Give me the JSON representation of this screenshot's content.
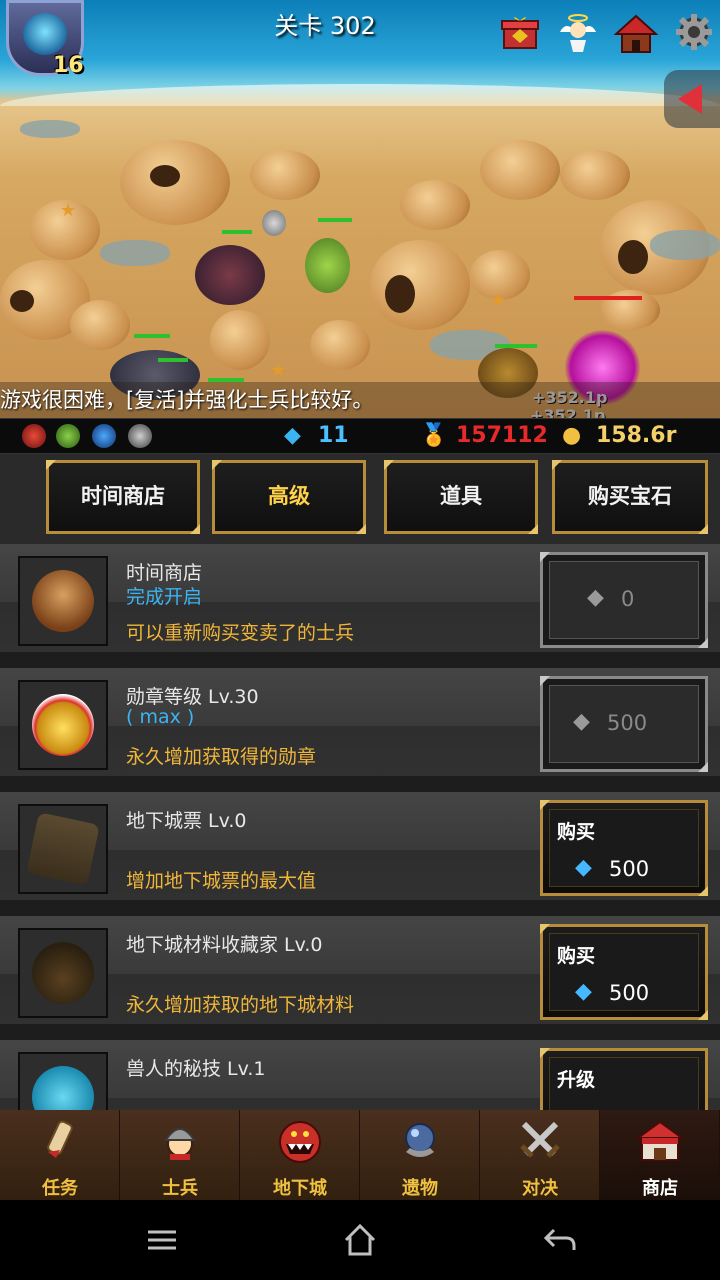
{
  "header": {
    "player_level": "16",
    "stage_title": "关卡 302",
    "icons": [
      "gift-box-icon",
      "angel-icon",
      "house-icon",
      "gear-icon"
    ]
  },
  "battle": {
    "scroll_message": "游戏很困难，[复活]并强化士兵比较好。",
    "floating_texts": [
      "+352.1p",
      "+352.1p"
    ]
  },
  "resources": {
    "gems": "11",
    "medals": "157112",
    "gold": "158.6r"
  },
  "tabs": [
    {
      "label": "时间商店",
      "active": false
    },
    {
      "label": "高级",
      "active": true
    },
    {
      "label": "道具",
      "active": false
    },
    {
      "label": "购买宝石",
      "active": false
    }
  ],
  "shop_items": [
    {
      "name": "时间商店",
      "status": "完成开启",
      "desc": "可以重新购买变卖了的士兵",
      "button_label": "",
      "price": "0",
      "enabled": false
    },
    {
      "name": "勋章等级 Lv.30",
      "status": "( max )",
      "desc": "永久增加获取得的勋章",
      "button_label": "",
      "price": "500",
      "enabled": false
    },
    {
      "name": "地下城票 Lv.0",
      "status": "",
      "desc": "增加地下城票的最大值",
      "button_label": "购买",
      "price": "500",
      "enabled": true
    },
    {
      "name": "地下城材料收藏家 Lv.0",
      "status": "",
      "desc": "永久增加获取的地下城材料",
      "button_label": "购买",
      "price": "500",
      "enabled": true
    },
    {
      "name": "兽人的秘技 Lv.1",
      "status": "",
      "desc": "",
      "button_label": "升级",
      "price": "",
      "enabled": true
    }
  ],
  "nav": [
    {
      "label": "任务",
      "icon": "scroll-icon",
      "active": false
    },
    {
      "label": "士兵",
      "icon": "helmet-icon",
      "active": false
    },
    {
      "label": "地下城",
      "icon": "monster-icon",
      "active": false
    },
    {
      "label": "遗物",
      "icon": "orb-icon",
      "active": false
    },
    {
      "label": "对决",
      "icon": "crossed-swords-icon",
      "active": false
    },
    {
      "label": "商店",
      "icon": "shop-icon",
      "active": true
    }
  ],
  "colors": {
    "accent_gold": "#f0b63a",
    "status_blue": "#3ab4f2",
    "medal_red": "#e21f1f",
    "tab_border": "#b88d3a"
  }
}
